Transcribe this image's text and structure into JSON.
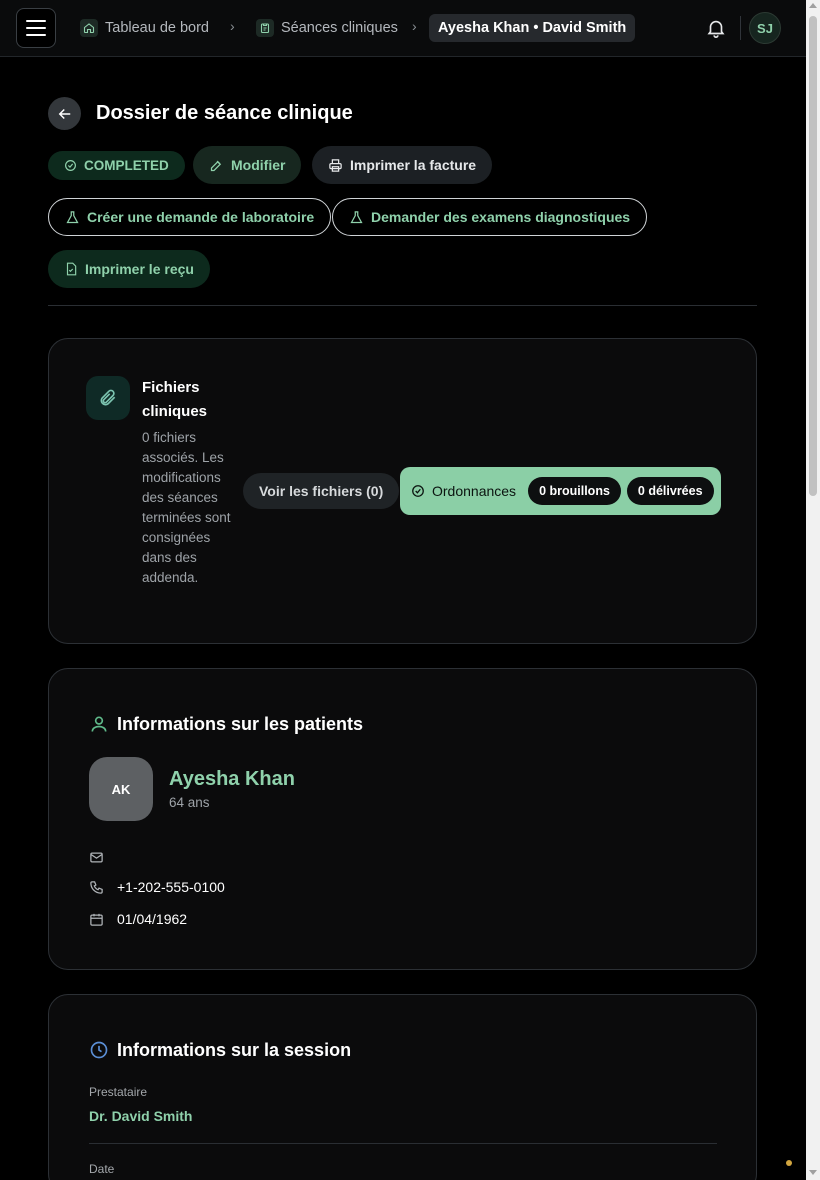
{
  "breadcrumb": {
    "items": [
      {
        "label": "Tableau de bord",
        "icon": "home-icon"
      },
      {
        "label": "Séances cliniques",
        "icon": "clipboard-icon"
      }
    ],
    "current": "Ayesha Khan • David Smith"
  },
  "user": {
    "initials": "SJ"
  },
  "header": {
    "title": "Dossier de séance clinique"
  },
  "actions": {
    "status": "COMPLETED",
    "edit": "Modifier",
    "print_invoice": "Imprimer la facture",
    "lab_request": "Créer une demande de laboratoire",
    "diagnostics": "Demander des examens diagnostiques",
    "print_receipt": "Imprimer le reçu"
  },
  "files": {
    "title": "Fichiers cliniques",
    "description": "0 fichiers associés. Les modifications des séances terminées sont consignées dans des addenda.",
    "view_button": "Voir les fichiers (0)",
    "prescriptions_label": "Ordonnances",
    "drafts": "0 brouillons",
    "delivered": "0 délivrées"
  },
  "patient": {
    "section_title": "Informations sur les patients",
    "initials": "AK",
    "name": "Ayesha Khan",
    "age": "64 ans",
    "email": "",
    "phone": "+1-202-555-0100",
    "dob": "01/04/1962"
  },
  "session": {
    "section_title": "Informations sur la session",
    "provider_label": "Prestataire",
    "provider": "Dr. David Smith",
    "date_label": "Date"
  },
  "colors": {
    "accent": "#8fd1ab",
    "background": "#000000",
    "card": "#0b0b0c"
  }
}
